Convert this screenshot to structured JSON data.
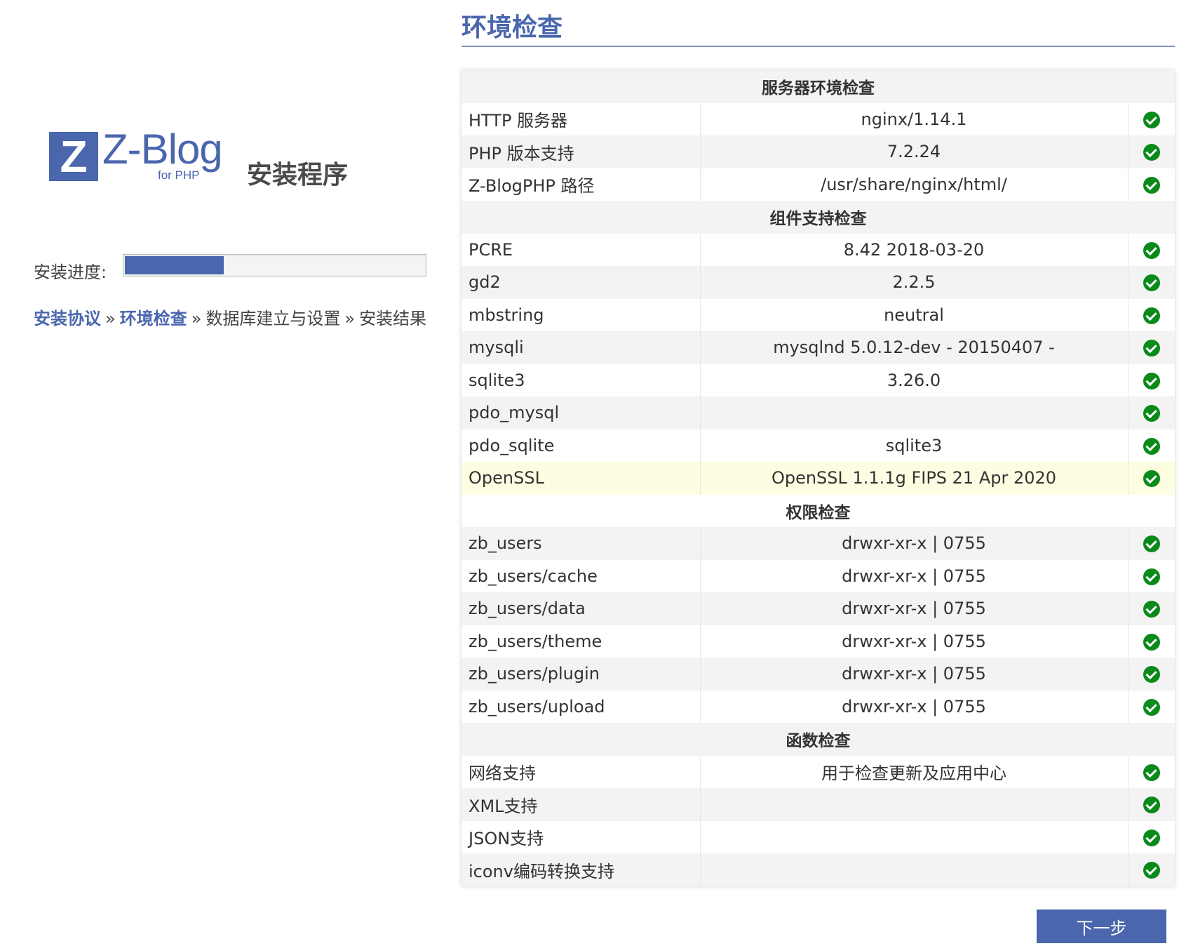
{
  "sidebar": {
    "logo": {
      "mark": "Z",
      "name": "Z-Blog",
      "sub": "for PHP",
      "title": "安装程序"
    },
    "progress": {
      "label": "安装进度:",
      "fraction": 0.33
    },
    "steps": [
      {
        "label": "安装协议",
        "state": "done"
      },
      {
        "label": "环境检查",
        "state": "done"
      },
      {
        "label": "数据库建立与设置",
        "state": "todo"
      },
      {
        "label": "安装结果",
        "state": "todo"
      }
    ],
    "separator": "»"
  },
  "main": {
    "title": "环境检查",
    "sections": [
      {
        "title": "服务器环境检查",
        "rows": [
          {
            "name": "HTTP 服务器",
            "value": "nginx/1.14.1"
          },
          {
            "name": "PHP 版本支持",
            "value": "7.2.24"
          },
          {
            "name": "Z-BlogPHP 路径",
            "value": "/usr/share/nginx/html/"
          }
        ]
      },
      {
        "title": "组件支持检查",
        "rows": [
          {
            "name": "PCRE",
            "value": "8.42 2018-03-20"
          },
          {
            "name": "gd2",
            "value": "2.2.5"
          },
          {
            "name": "mbstring",
            "value": "neutral"
          },
          {
            "name": "mysqli",
            "value": "mysqlnd 5.0.12-dev - 20150407 -"
          },
          {
            "name": "sqlite3",
            "value": "3.26.0"
          },
          {
            "name": "pdo_mysql",
            "value": ""
          },
          {
            "name": "pdo_sqlite",
            "value": "sqlite3"
          },
          {
            "name": "OpenSSL",
            "value": "OpenSSL 1.1.1g FIPS 21 Apr 2020",
            "highlight": true
          }
        ]
      },
      {
        "title": "权限检查",
        "rows": [
          {
            "name": "zb_users",
            "value": "drwxr-xr-x | 0755"
          },
          {
            "name": "zb_users/cache",
            "value": "drwxr-xr-x | 0755"
          },
          {
            "name": "zb_users/data",
            "value": "drwxr-xr-x | 0755"
          },
          {
            "name": "zb_users/theme",
            "value": "drwxr-xr-x | 0755"
          },
          {
            "name": "zb_users/plugin",
            "value": "drwxr-xr-x | 0755"
          },
          {
            "name": "zb_users/upload",
            "value": "drwxr-xr-x | 0755"
          }
        ]
      },
      {
        "title": "函数检查",
        "rows": [
          {
            "name": "网络支持",
            "value": "用于检查更新及应用中心"
          },
          {
            "name": "XML支持",
            "value": ""
          },
          {
            "name": "JSON支持",
            "value": ""
          },
          {
            "name": "iconv编码转换支持",
            "value": ""
          }
        ]
      }
    ],
    "status_icon": "check-circle-icon",
    "next_label": "下一步"
  },
  "colors": {
    "accent": "#4a66ad",
    "ok": "#0a8a1a",
    "highlight_row": "#fdfde2"
  }
}
